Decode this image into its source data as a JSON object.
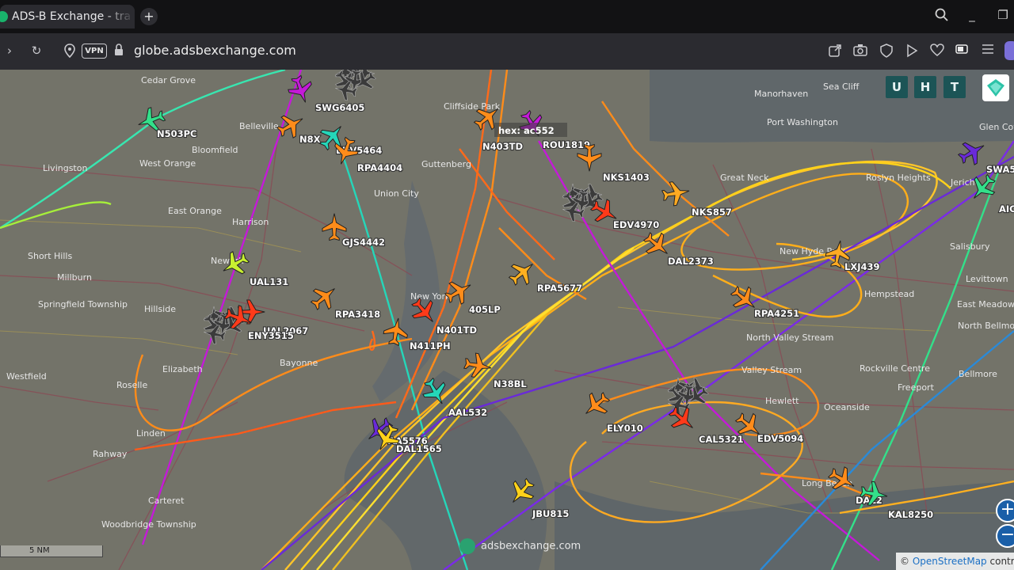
{
  "tab": {
    "title": "ADS-B Exchange - tra",
    "new_tab": "+"
  },
  "window": {
    "minimize": "_",
    "restore": "❐"
  },
  "navbar": {
    "forward": "›",
    "reload": "↻",
    "vpn": "VPN",
    "url_domain": "globe.adsbexchange.com"
  },
  "map": {
    "buttons": {
      "u": "U",
      "h": "H",
      "t": "T"
    },
    "zoom_in": "+",
    "zoom_out": "−",
    "scale_label": "5 NM",
    "watermark": "adsbexchange.com",
    "attribution_symbol": "©",
    "attribution_link": "OpenStreetMap",
    "attribution_tail": "contrib",
    "hex_label": "hex: ac552",
    "aircraft": [
      {
        "callsign": "N503PC",
        "color": "#33e08a"
      },
      {
        "callsign": "SWG6405",
        "color": "#c41ad8"
      },
      {
        "callsign": "N8X",
        "color": "#ff8c1a"
      },
      {
        "callsign": "EDV5464",
        "color": "#25d6b9"
      },
      {
        "callsign": "RPA4404",
        "color": "#ff8c1a"
      },
      {
        "callsign": "N403TD",
        "color": "#ff8c1a"
      },
      {
        "callsign": "ROU1819",
        "color": "#c41ad8"
      },
      {
        "callsign": "NKS1403",
        "color": "#ff8c1a"
      },
      {
        "callsign": "NKS857",
        "color": "#ffaa22"
      },
      {
        "callsign": "EDV4970",
        "color": "#ff3a1a"
      },
      {
        "callsign": "DAL2373",
        "color": "#ff8c1a"
      },
      {
        "callsign": "LXJ439",
        "color": "#ffaa22"
      },
      {
        "callsign": "GJS4442",
        "color": "#ff8c1a"
      },
      {
        "callsign": "UAL131",
        "color": "#c8f030"
      },
      {
        "callsign": "UAL2067",
        "color": "#ff3a1a"
      },
      {
        "callsign": "ENY3515",
        "color": "#ff3a1a"
      },
      {
        "callsign": "RPA3418",
        "color": "#ff8c1a"
      },
      {
        "callsign": "RPA5677",
        "color": "#ffb020"
      },
      {
        "callsign": "405LP",
        "color": "#ff8c1a"
      },
      {
        "callsign": "N401TD",
        "color": "#ff3a1a"
      },
      {
        "callsign": "N411PH",
        "color": "#ff8c1a"
      },
      {
        "callsign": "RPA4251",
        "color": "#ff8c1a"
      },
      {
        "callsign": "N38BL",
        "color": "#ff8c1a"
      },
      {
        "callsign": "AAL532",
        "color": "#25d6b9"
      },
      {
        "callsign": "AA5576",
        "color": "#6a2ad8"
      },
      {
        "callsign": "DAL1565",
        "color": "#ffd21a"
      },
      {
        "callsign": "ELY010",
        "color": "#ff8c1a"
      },
      {
        "callsign": "CAL5321",
        "color": "#ff3a1a"
      },
      {
        "callsign": "EDV5094",
        "color": "#ff8c1a"
      },
      {
        "callsign": "JBU815",
        "color": "#ffd21a"
      },
      {
        "callsign": "DAL2",
        "color": "#ff8c1a"
      },
      {
        "callsign": "KAL8250",
        "color": "#33e08a"
      },
      {
        "callsign": "SWA5",
        "color": "#6a2ad8"
      },
      {
        "callsign": "AIC",
        "color": "#33e08a"
      }
    ],
    "places": [
      "Cedar Grove",
      "Livingston",
      "Bloomfield",
      "West Orange",
      "East Orange",
      "Short Hills",
      "Millburn",
      "Springfield Township",
      "Elizabeth",
      "Westfield",
      "Roselle",
      "Linden",
      "Rahway",
      "Carteret",
      "Woodbridge Township",
      "Bayonne",
      "New York",
      "Sea Cliff",
      "Manorhaven",
      "Port Washington",
      "Glen Cove",
      "Roslyn Heights",
      "Great Neck",
      "New Hyde Park",
      "Hempstead",
      "Levittown",
      "East Meadow",
      "North Bellmore",
      "Valley Stream",
      "Rockville Centre",
      "Freeport",
      "Hewlett",
      "Oceanside",
      "Long Beach",
      "Bellmore",
      "Jericho",
      "Salisbury",
      "Cliffside Park",
      "Guttenberg",
      "Union City",
      "Harrison",
      "Belleville",
      "Newark",
      "Hillside",
      "North Valley Stream"
    ]
  }
}
